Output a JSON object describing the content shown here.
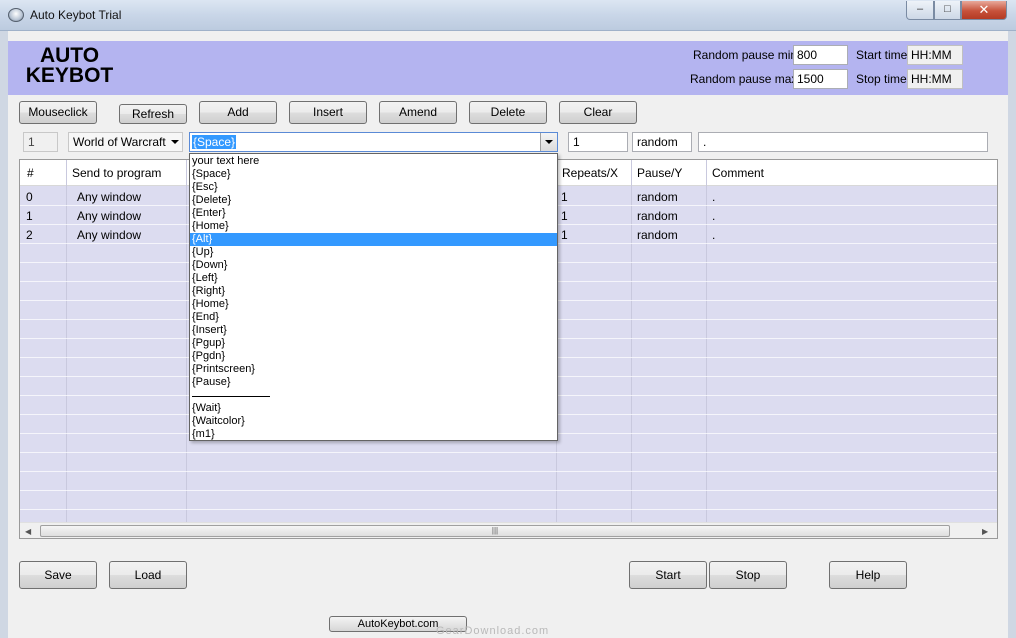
{
  "window": {
    "title": "Auto Keybot Trial",
    "minimize": "‒",
    "maximize": "□",
    "close": "✕"
  },
  "header": {
    "logo_line1": "AUTO",
    "logo_line2": "KEYBOT",
    "random_pause_min_label": "Random pause min",
    "random_pause_min_value": "800",
    "random_pause_max_label": "Random pause max",
    "random_pause_max_value": "1500",
    "start_time_label": "Start time",
    "start_time_value": "HH:MM",
    "stop_time_label": "Stop time",
    "stop_time_value": "HH:MM"
  },
  "toolbar": {
    "mouseclick": "Mouseclick",
    "refresh": "Refresh",
    "add": "Add",
    "insert": "Insert",
    "amend": "Amend",
    "delete": "Delete",
    "clear": "Clear"
  },
  "edit_row": {
    "index": "1",
    "program": "World of Warcraft",
    "key": "{Space}",
    "repeats": "1",
    "pause": "random",
    "comment": "."
  },
  "grid": {
    "columns": [
      "#",
      "Send to program",
      "Repeats/X",
      "Pause/Y",
      "Comment"
    ],
    "rows": [
      {
        "num": "0",
        "program": "Any window",
        "repeats": "1",
        "pause": "random",
        "comment": "."
      },
      {
        "num": "1",
        "program": "Any window",
        "repeats": "1",
        "pause": "random",
        "comment": "."
      },
      {
        "num": "2",
        "program": "Any window",
        "repeats": "1",
        "pause": "random",
        "comment": "."
      }
    ],
    "scroll_grip": "|||"
  },
  "dropdown": {
    "selected_index": 6,
    "items": [
      "your text here",
      "{Space}",
      "{Esc}",
      "{Delete}",
      "{Enter}",
      "{Home}",
      "{Alt}",
      "{Up}",
      "{Down}",
      "{Left}",
      "{Right}",
      "{Home}",
      "{End}",
      "{Insert}",
      "{Pgup}",
      "{Pgdn}",
      "{Printscreen}",
      "{Pause}",
      "",
      "{Wait}",
      "{Waitcolor}",
      "{m1}"
    ]
  },
  "bottom": {
    "save": "Save",
    "load": "Load",
    "start": "Start",
    "stop": "Stop",
    "help": "Help",
    "website": "AutoKeybot.com",
    "watermark": "GearDownload.com"
  }
}
